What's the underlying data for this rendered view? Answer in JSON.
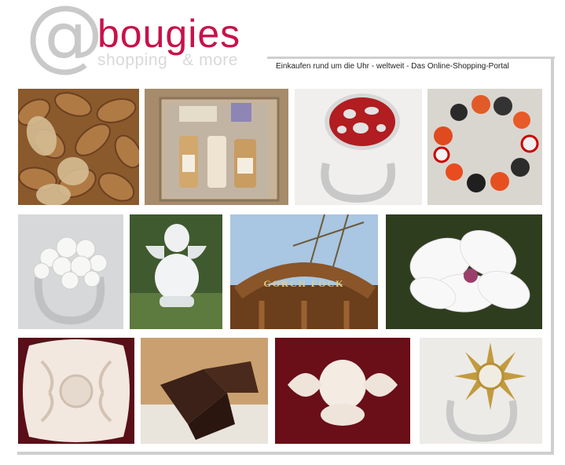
{
  "header": {
    "logo": {
      "symbol": "@",
      "name": "bougies",
      "tagline_left": "shopping",
      "tagline_right": "& more"
    },
    "tagline": "Einkaufen rund um die Uhr - weltweit - Das Online-Shopping-Portal"
  },
  "gallery": {
    "rows": [
      [
        "almonds",
        "bath-gift-set",
        "red-enamel-ring",
        "bead-bracelet"
      ],
      [
        "white-rose-ring",
        "angel-garden-statue",
        "ships-wheel",
        "magnolia-blossom"
      ],
      [
        "stucco-ornament",
        "chocolate",
        "angel-relief",
        "sun-ring"
      ]
    ],
    "ships_wheel_lettering": "GORCH FOCK"
  },
  "colors": {
    "brand": "#c8124a",
    "logo_grey": "#c9c9c9",
    "frame": "#cfcfcf"
  }
}
